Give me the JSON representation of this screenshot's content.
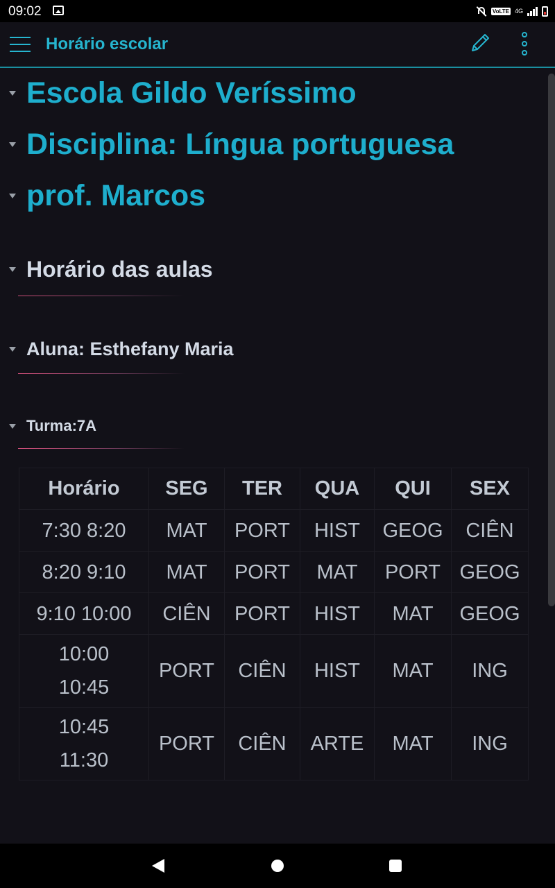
{
  "status_bar": {
    "time": "09:02",
    "volte": "VoLTE",
    "network": "4G",
    "icons": [
      "image-icon",
      "notifications-off-icon",
      "signal-icon",
      "battery-icon"
    ]
  },
  "app_bar": {
    "title": "Horário escolar",
    "icons": [
      "menu-icon",
      "edit-pencil-icon",
      "more-vert-icon"
    ],
    "accent_color": "#26b5cf"
  },
  "headings": {
    "school": "Escola Gildo Veríssimo",
    "subject": "Disciplina: Língua portuguesa",
    "teacher": "prof. Marcos",
    "schedule": "Horário das aulas",
    "student": "Aluna: Esthefany Maria",
    "class": "Turma:7A"
  },
  "table": {
    "headers": [
      "Horário",
      "SEG",
      "TER",
      "QUA",
      "QUI",
      "SEX"
    ],
    "rows": [
      [
        "7:30 8:20",
        "MAT",
        "PORT",
        "HIST",
        "GEOG",
        "CIÊN"
      ],
      [
        "8:20 9:10",
        "MAT",
        "PORT",
        "MAT",
        "PORT",
        "GEOG"
      ],
      [
        "9:10 10:00",
        "CIÊN",
        "PORT",
        "HIST",
        "MAT",
        "GEOG"
      ],
      [
        "10:00 10:45",
        "PORT",
        "CIÊN",
        "HIST",
        "MAT",
        "ING"
      ],
      [
        "10:45 11:30",
        "PORT",
        "CIÊN",
        "ARTE",
        "MAT",
        "ING"
      ]
    ]
  },
  "nav_bar": {
    "icons": [
      "back-icon",
      "home-icon",
      "recents-icon"
    ]
  }
}
